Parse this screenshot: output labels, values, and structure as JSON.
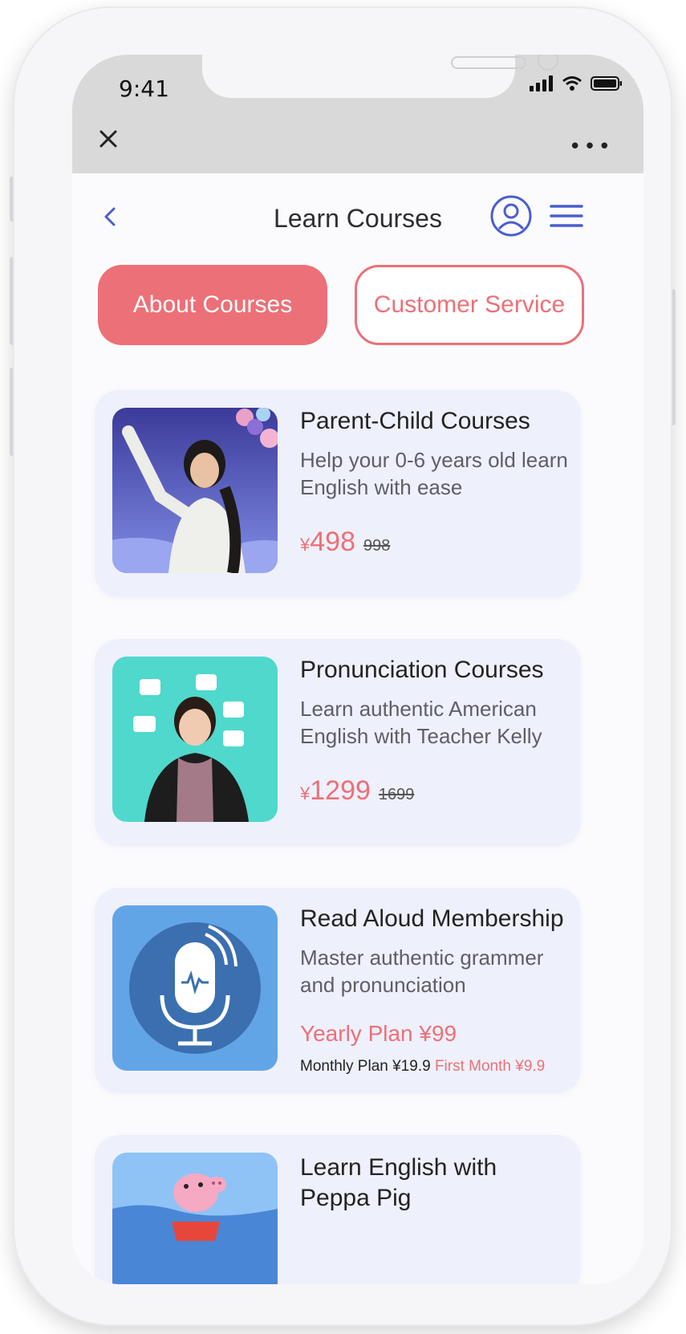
{
  "status_bar": {
    "time": "9:41"
  },
  "browser_bar": {
    "close_icon": "close-icon",
    "more_label": "•••"
  },
  "header": {
    "title": "Learn Courses",
    "back_icon": "back-chevron-icon",
    "profile_icon": "user-icon",
    "menu_icon": "hamburger-icon"
  },
  "tabs": [
    {
      "label": "About Courses",
      "active": true
    },
    {
      "label": "Customer Service",
      "active": false
    }
  ],
  "colors": {
    "accent": "#ec7077",
    "primary": "#4a5ecf",
    "card_bg": "#eef0fb"
  },
  "courses": [
    {
      "title": "Parent-Child Courses",
      "description": "Help your 0-6 years old learn English with ease",
      "currency": "¥",
      "price": "498",
      "original_price": "998"
    },
    {
      "title": "Pronunciation Courses",
      "description": "Learn authentic American English with Teacher Kelly",
      "currency": "¥",
      "price": "1299",
      "original_price": "1699"
    },
    {
      "title": "Read Aloud Membership",
      "description": "Master authentic grammer and pronunciation",
      "yearly_plan": "Yearly Plan ¥99",
      "monthly_plan": "Monthly Plan ¥19.9",
      "first_month": "First Month ¥9.9"
    },
    {
      "title": "Learn English with Peppa Pig"
    }
  ]
}
